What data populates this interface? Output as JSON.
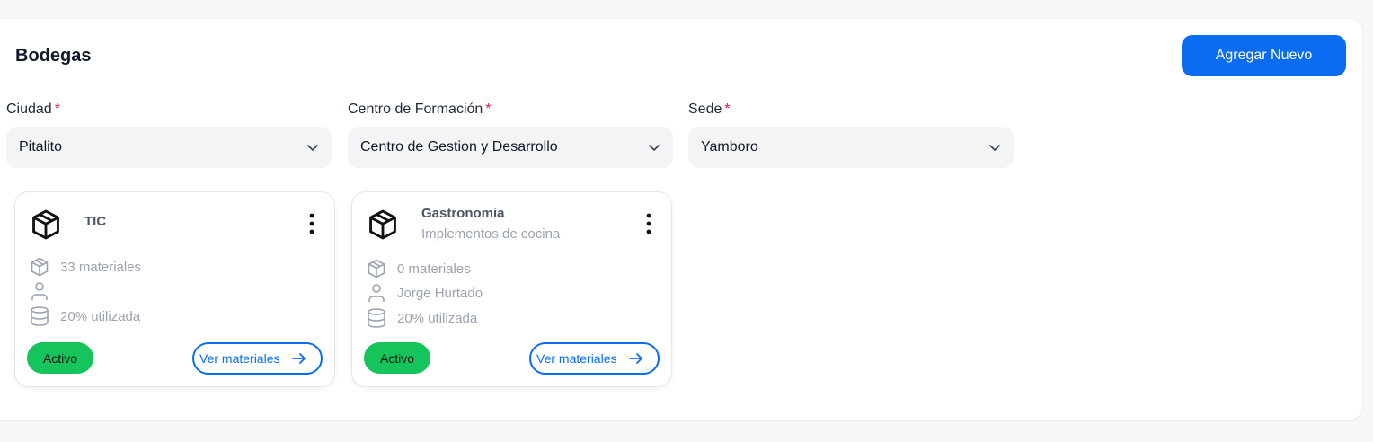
{
  "page": {
    "title": "Bodegas",
    "add_button": "Agregar Nuevo"
  },
  "filters": [
    {
      "label": "Ciudad",
      "required_mark": "*",
      "value": "Pitalito"
    },
    {
      "label": "Centro de Formación",
      "required_mark": "*",
      "value": "Centro de Gestion y Desarrollo"
    },
    {
      "label": "Sede",
      "required_mark": "*",
      "value": "Yamboro"
    }
  ],
  "cards": [
    {
      "title": "TIC",
      "subtitle": "",
      "materials": "33 materiales",
      "responsible": "",
      "usage": "20% utilizada",
      "status": "Activo",
      "action": "Ver materiales"
    },
    {
      "title": "Gastronomia",
      "subtitle": "Implementos de cocina",
      "materials": "0 materiales",
      "responsible": "Jorge Hurtado",
      "usage": "20% utilizada",
      "status": "Activo",
      "action": "Ver materiales"
    }
  ],
  "colors": {
    "primary": "#0a6cf0",
    "status_active": "#16c45c",
    "required": "#e11d48"
  }
}
